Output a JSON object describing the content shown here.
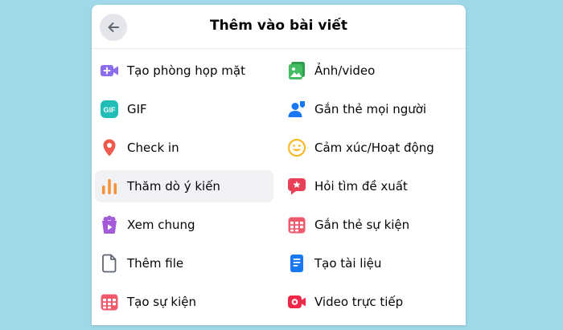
{
  "header": {
    "title": "Thêm vào bài viết",
    "back_icon": "arrow-left-icon"
  },
  "items_left": [
    {
      "label": "Tạo phòng họp mặt",
      "icon": "video-call-icon",
      "color": "#8b6cf0"
    },
    {
      "label": "GIF",
      "icon": "gif-icon",
      "color": "#1fbfb8"
    },
    {
      "label": "Check in",
      "icon": "location-pin-icon",
      "color": "#f0584c"
    },
    {
      "label": "Thăm dò ý kiến",
      "icon": "poll-icon",
      "color": "#f6913a"
    },
    {
      "label": "Xem chung",
      "icon": "watch-party-icon",
      "color": "#a45bd9"
    },
    {
      "label": "Thêm file",
      "icon": "file-icon",
      "color": "#606770"
    },
    {
      "label": "Tạo sự kiện",
      "icon": "calendar-icon",
      "color": "#f05a6c"
    }
  ],
  "items_right": [
    {
      "label": "Ảnh/video",
      "icon": "photo-video-icon",
      "color": "#45bd62"
    },
    {
      "label": "Gắn thẻ mọi người",
      "icon": "tag-people-icon",
      "color": "#1877f2"
    },
    {
      "label": "Cảm xúc/Hoạt động",
      "icon": "feeling-emoji-icon",
      "color": "#f7b928"
    },
    {
      "label": "Hỏi tìm đề xuất",
      "icon": "recommendation-icon",
      "color": "#e84157"
    },
    {
      "label": "Gắn thẻ sự kiện",
      "icon": "tag-event-icon",
      "color": "#f05a6c"
    },
    {
      "label": "Tạo tài liệu",
      "icon": "document-icon",
      "color": "#1877f2"
    },
    {
      "label": "Video trực tiếp",
      "icon": "live-video-icon",
      "color": "#f02849"
    }
  ]
}
